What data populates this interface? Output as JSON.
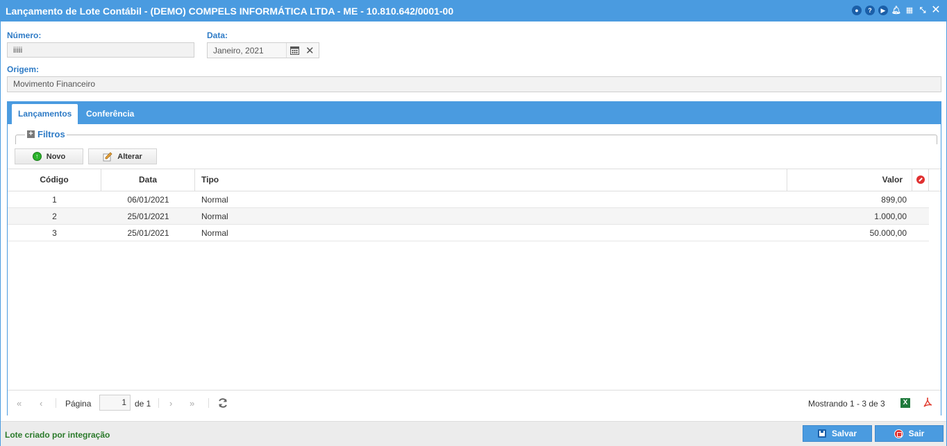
{
  "window": {
    "title": "Lançamento de Lote Contábil - (DEMO) COMPELS INFORMÁTICA LTDA - ME - 10.810.642/0001-00"
  },
  "form": {
    "numero_label": "Número:",
    "numero_value": "iiiii",
    "data_label": "Data:",
    "data_value": "Janeiro, 2021",
    "origem_label": "Origem:",
    "origem_value": "Movimento Financeiro"
  },
  "tabs": [
    {
      "label": "Lançamentos",
      "active": true
    },
    {
      "label": "Conferência",
      "active": false
    }
  ],
  "filters": {
    "label": "Filtros"
  },
  "toolbar": {
    "novo_label": "Novo",
    "alterar_label": "Alterar"
  },
  "grid": {
    "columns": [
      "Código",
      "Data",
      "Tipo",
      "Valor"
    ],
    "rows": [
      {
        "codigo": "1",
        "data": "06/01/2021",
        "tipo": "Normal",
        "valor": "899,00"
      },
      {
        "codigo": "2",
        "data": "25/01/2021",
        "tipo": "Normal",
        "valor": "1.000,00"
      },
      {
        "codigo": "3",
        "data": "25/01/2021",
        "tipo": "Normal",
        "valor": "50.000,00"
      }
    ]
  },
  "pager": {
    "pagina_label": "Página",
    "page_value": "1",
    "of_label": "de 1",
    "summary": "Mostrando 1 - 3 de 3",
    "excel_icon_text": "X"
  },
  "footer": {
    "status": "Lote criado por integração",
    "salvar_label": "Salvar",
    "sair_label": "Sair"
  },
  "colors": {
    "accent": "#4a9be0",
    "label_blue": "#2e7bc6",
    "status_green": "#2a7a2a"
  }
}
